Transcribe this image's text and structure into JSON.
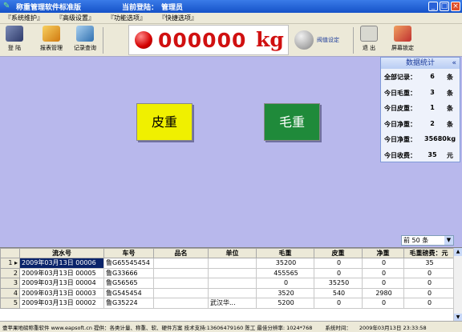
{
  "titlebar": {
    "title": "称重管理软件标准版",
    "login_label": "当前登陆：",
    "login_user": "管理员",
    "minimize": "_",
    "maximize": "□",
    "close": "×"
  },
  "menu": [
    "『系统维护』",
    "『高级设置』",
    "『功能选项』",
    "『快捷选项』"
  ],
  "toolbar": {
    "login": "登  陆",
    "report": "报表管理",
    "records": "记录查询",
    "threshold": "阀值设定",
    "exit": "退  出",
    "lock": "屏幕锁定"
  },
  "display": {
    "weight": "000000",
    "unit": "kg"
  },
  "stats": {
    "title": "数据统计",
    "collapse": "«",
    "rows": [
      {
        "label": "全部记录：",
        "value": "6",
        "unit": "条"
      },
      {
        "label": "今日毛重：",
        "value": "3",
        "unit": "条"
      },
      {
        "label": "今日皮重：",
        "value": "1",
        "unit": "条"
      },
      {
        "label": "今日净重：",
        "value": "2",
        "unit": "条"
      },
      {
        "label": "今日净重：",
        "value": "35680",
        "unit": "kg"
      },
      {
        "label": "今日收费：",
        "value": "35",
        "unit": "元"
      }
    ]
  },
  "buttons": {
    "tare": "皮重",
    "gross": "毛重"
  },
  "pagesize": {
    "value": "前 50 条",
    "arrow": "▼"
  },
  "table": {
    "columns": [
      "流水号",
      "车号",
      "品名",
      "单位",
      "毛重",
      "皮重",
      "净重",
      "毛重磅费：元"
    ],
    "rows": [
      {
        "n": "1",
        "marker": "▸",
        "serial": "2009年03月13日  00006",
        "plate": "鲁G65545454",
        "product": "",
        "unit": "",
        "gross": "35200",
        "tare": "0",
        "net": "0",
        "fee": "35"
      },
      {
        "n": "2",
        "marker": "",
        "serial": "2009年03月13日  00005",
        "plate": "鲁G33666",
        "product": "",
        "unit": "",
        "gross": "455565",
        "tare": "0",
        "net": "0",
        "fee": "0"
      },
      {
        "n": "3",
        "marker": "",
        "serial": "2009年03月13日  00004",
        "plate": "鲁G56565",
        "product": "",
        "unit": "",
        "gross": "0",
        "tare": "35250",
        "net": "0",
        "fee": "0"
      },
      {
        "n": "4",
        "marker": "",
        "serial": "2009年03月13日  00003",
        "plate": "鲁G545454",
        "product": "",
        "unit": "",
        "gross": "3520",
        "tare": "540",
        "net": "2980",
        "fee": "0"
      },
      {
        "n": "5",
        "marker": "",
        "serial": "2009年03月13日  00002",
        "plate": "鲁G35224",
        "product": "",
        "unit": "武汉华...",
        "gross": "5200",
        "tare": "0",
        "net": "0",
        "fee": "0"
      }
    ]
  },
  "statusbar": {
    "left": "壹苹果地磅称重软件 www.eapsoft.cn  提供：各类计量、称重、软、硬件方案  技术支持:13606479160 陈工  最佳分辨率: 1024*768",
    "time_label": "系统时间：",
    "time": "2009年03月13日 23:33:58"
  }
}
